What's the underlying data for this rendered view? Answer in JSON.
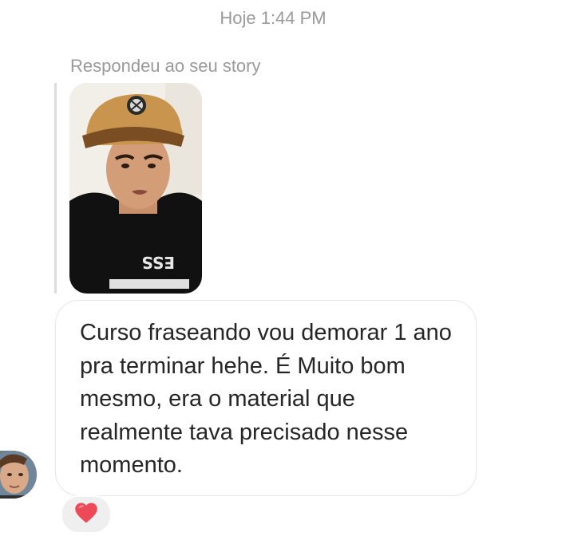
{
  "thread": {
    "timestamp": "Hoje 1:44 PM",
    "reply_context": "Respondeu ao seu story",
    "message": {
      "text": "Curso fraseando vou demorar 1 ano pra terminar hehe. É Muito bom mesmo, era o material que realmente tava precisado nesse momento."
    },
    "reaction": {
      "icon": "heart-icon",
      "color": "#ed4956"
    }
  },
  "colors": {
    "meta_text": "#9a9a9a",
    "message_text": "#262626",
    "bubble_border": "#e6e6e6",
    "reaction_bg": "#efefef"
  }
}
